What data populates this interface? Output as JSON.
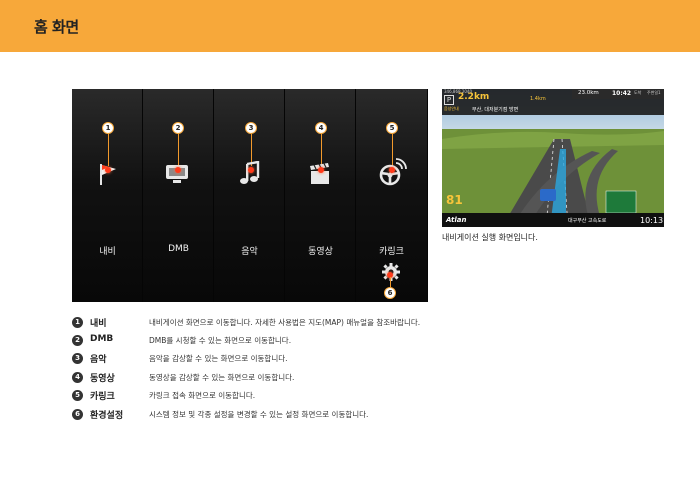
{
  "header": {
    "title": "홈 화면",
    "color": "#f7a83a"
  },
  "home_screen": {
    "items": [
      {
        "number": "1",
        "label": "내비",
        "icon": "flag-icon"
      },
      {
        "number": "2",
        "label": "DMB",
        "icon": "tv-icon"
      },
      {
        "number": "3",
        "label": "음악",
        "icon": "music-note-icon"
      },
      {
        "number": "4",
        "label": "동영상",
        "icon": "clapperboard-icon"
      },
      {
        "number": "5",
        "label": "카링크",
        "icon": "steering-wheel-wifi-icon"
      }
    ],
    "settings": {
      "number": "6",
      "icon": "gear-icon"
    }
  },
  "nav_screenshot": {
    "top_left_small": "346,868 2040",
    "distance": "2.2km",
    "lane_distance": "1.4km",
    "direction_text": "부산, 대저분기점 방면",
    "mode_label": "음성안내",
    "speed_info": "23.0km",
    "time_top": "10:42",
    "time_suffix": "도착",
    "top_right_label": "주변일1",
    "speed_limit": "81",
    "road_name": "대구부산 고속도로",
    "clock": "10:13",
    "brand": "Atlan",
    "caption": "내비게이션 실행 화면입니다."
  },
  "descriptions": [
    {
      "number": "1",
      "term": "내비",
      "text": "내비게이션 화면으로 이동합니다. 자세한 사용법은 지도(MAP) 매뉴얼을 참조바랍니다."
    },
    {
      "number": "2",
      "term": "DMB",
      "text": "DMB를 시청할 수 있는 화면으로 이동합니다."
    },
    {
      "number": "3",
      "term": "음악",
      "text": "음악을 감상할 수 있는 화면으로 이동합니다."
    },
    {
      "number": "4",
      "term": "동영상",
      "text": "동영상을 감상할 수 있는 화면으로 이동합니다."
    },
    {
      "number": "5",
      "term": "카링크",
      "text": "카링크 접속 화면으로 이동합니다."
    },
    {
      "number": "6",
      "term": "환경설정",
      "text": "시스템 정보 및 각종 설정을 변경할 수 있는 설정 화면으로 이동합니다."
    }
  ]
}
